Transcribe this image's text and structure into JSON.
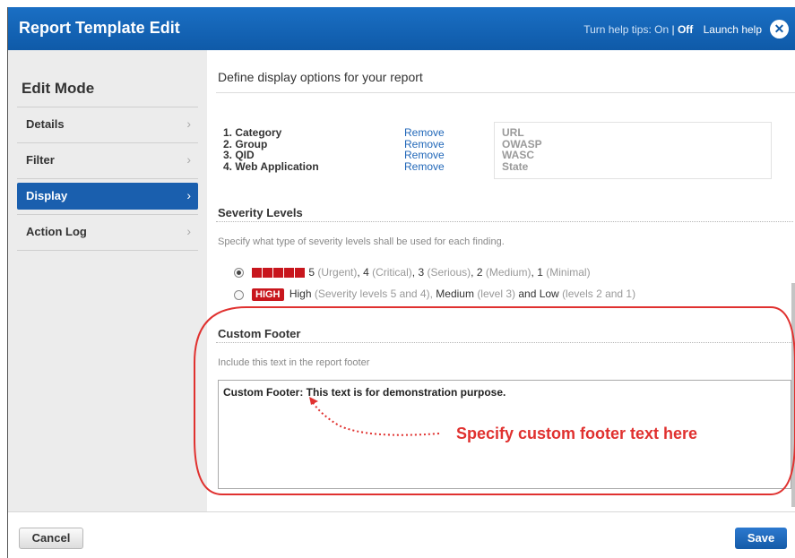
{
  "titlebar": {
    "title": "Report Template Edit",
    "help_prefix": "Turn help tips:",
    "help_on": "On",
    "help_sep": " | ",
    "help_off": "Off",
    "launch_help": "Launch help",
    "close_glyph": "✕"
  },
  "sidebar": {
    "mode_title": "Edit Mode",
    "items": [
      {
        "label": "Details",
        "active": false
      },
      {
        "label": "Filter",
        "active": false
      },
      {
        "label": "Display",
        "active": true
      },
      {
        "label": "Action Log",
        "active": false
      }
    ],
    "chevron": "›"
  },
  "main": {
    "heading": "Define display options for your report",
    "sort_items": [
      "1. Category",
      "2. Group",
      "3. QID",
      "4. Web Application"
    ],
    "remove_label": "Remove",
    "available_items": [
      "URL",
      "OWASP",
      "WASC",
      "State"
    ],
    "severity": {
      "title": "Severity Levels",
      "description": "Specify what type of severity levels shall be used for each finding.",
      "option1": {
        "selected": true,
        "n5": "5",
        "t5": "(Urgent)",
        "n4": "4",
        "t4": "(Critical)",
        "n3": "3",
        "t3": "(Serious)",
        "n2": "2",
        "t2": "(Medium)",
        "n1": "1",
        "t1": "(Minimal)"
      },
      "option2": {
        "selected": false,
        "badge": "HIGH",
        "high": "High",
        "high_note": "(Severity levels 5 and 4),",
        "medium": "Medium",
        "medium_note": "(level 3)",
        "and_low": "and Low",
        "low_note": "(levels 2 and 1)"
      }
    },
    "footer_section": {
      "title": "Custom Footer",
      "description": "Include this text in the report footer",
      "value": "Custom Footer: This text is for demonstration purpose."
    },
    "annotation": "Specify custom footer text here"
  },
  "buttons": {
    "cancel": "Cancel",
    "save": "Save"
  },
  "colors": {
    "title_bar": "#1265b8",
    "active_nav": "#1a5fae",
    "severity_red": "#c8161d",
    "annotation_red": "#e0312f"
  }
}
